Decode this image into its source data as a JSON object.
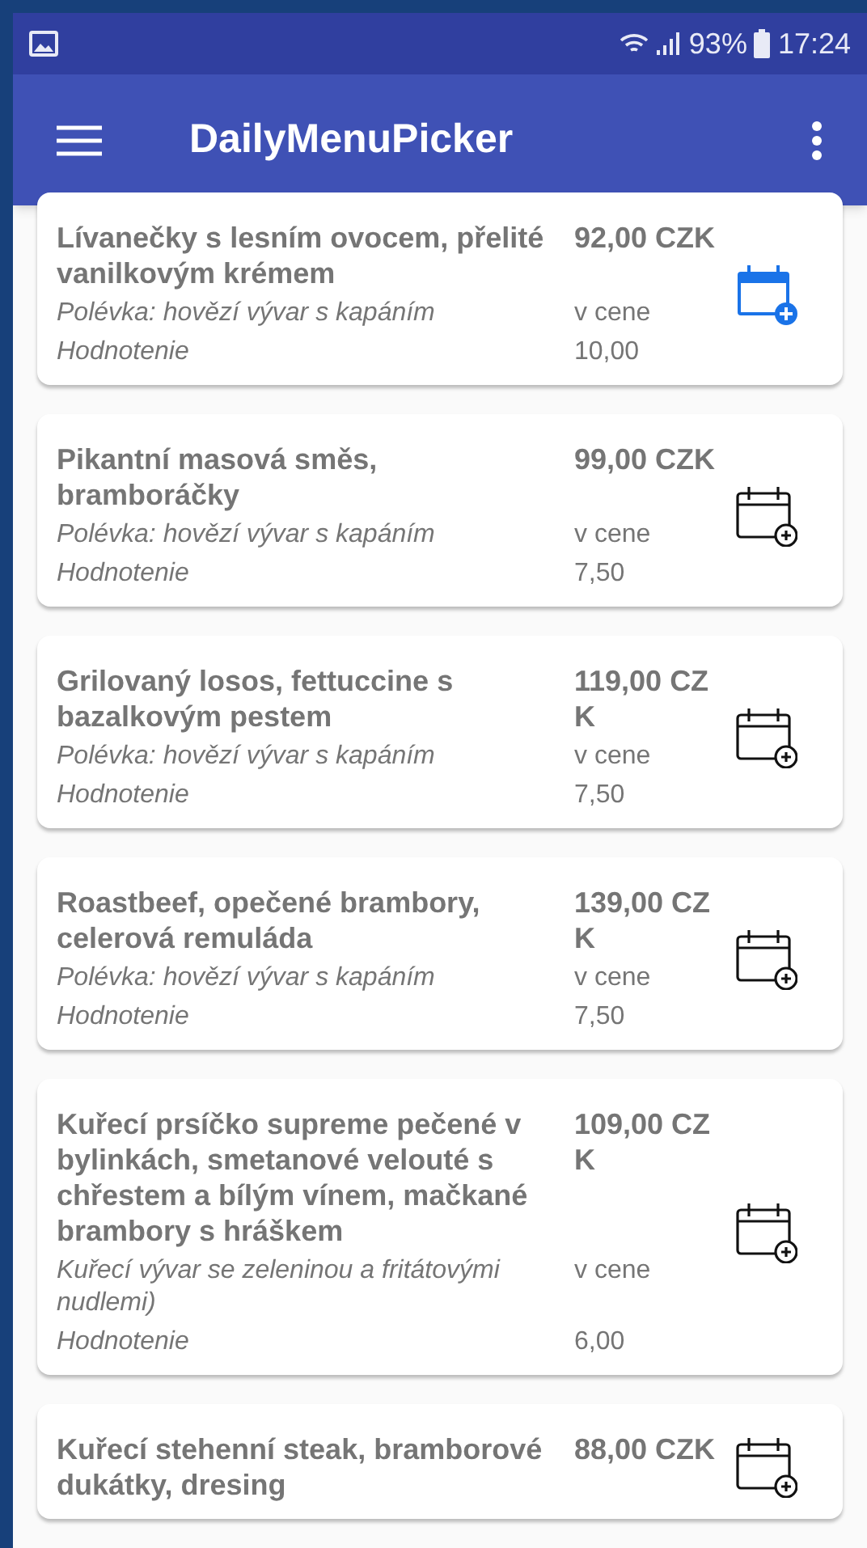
{
  "status_bar": {
    "battery": "93%",
    "time": "17:24"
  },
  "app_bar": {
    "title": "DailyMenuPicker"
  },
  "meals": [
    {
      "name": "Lívanečky s lesním ovocem, přelité vanilkovým krémem",
      "price": "92,00 CZK",
      "soup": "Polévka: hovězí vývar s kapáním",
      "soup_price": "v cene",
      "rating_label": "Hodnotenie",
      "rating": "10,00",
      "selected": true
    },
    {
      "name": "Pikantní masová směs, bramboráčky",
      "price": "99,00 CZK",
      "soup": "Polévka: hovězí vývar s kapáním",
      "soup_price": "v cene",
      "rating_label": "Hodnotenie",
      "rating": "7,50",
      "selected": false
    },
    {
      "name": "Grilovaný losos, fettuccine s bazalkovým pestem",
      "price": "119,00 CZK",
      "soup": "Polévka: hovězí vývar s kapáním",
      "soup_price": "v cene",
      "rating_label": "Hodnotenie",
      "rating": "7,50",
      "selected": false
    },
    {
      "name": "Roastbeef, opečené brambory, celerová remuláda",
      "price": "139,00 CZK",
      "soup": "Polévka: hovězí vývar s kapáním",
      "soup_price": "v cene",
      "rating_label": "Hodnotenie",
      "rating": "7,50",
      "selected": false
    },
    {
      "name": "Kuřecí prsíčko supreme pečené v bylinkách, smetanové velouté s chřestem a bílým vínem, mačkané brambory s hráškem",
      "price": "109,00 CZK",
      "soup": "Kuřecí vývar se zeleninou a fritátovými nudlemi)",
      "soup_price": "v cene",
      "rating_label": "Hodnotenie",
      "rating": "6,00",
      "selected": false
    },
    {
      "name": "Kuřecí stehenní steak, bramborové dukátky, dresing",
      "price": "88,00 CZK",
      "selected": false
    }
  ]
}
